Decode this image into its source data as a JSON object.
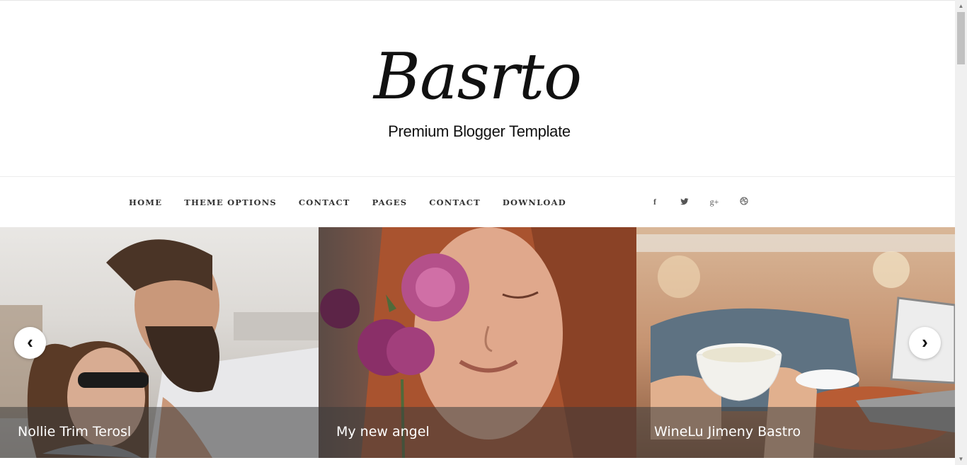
{
  "header": {
    "logo": "Basrto",
    "tagline": "Premium Blogger Template"
  },
  "nav": {
    "items": [
      "HOME",
      "THEME OPTIONS",
      "CONTACT",
      "PAGES",
      "CONTACT",
      "DOWNLOAD"
    ]
  },
  "social": {
    "icons": [
      "facebook-icon",
      "twitter-icon",
      "google-plus-icon",
      "dribbble-icon"
    ],
    "glyphs": [
      "f",
      "🐦",
      "g+",
      "⊛"
    ]
  },
  "slider": {
    "slides": [
      {
        "caption": "Nollie Trim Terosl"
      },
      {
        "caption": "My new angel"
      },
      {
        "caption": "WineLu Jimeny Bastro"
      }
    ],
    "prev_glyph": "‹",
    "next_glyph": "›"
  },
  "colors": {
    "text": "#111111",
    "nav_text": "#333333",
    "caption_overlay": "rgba(60,60,60,0.55)"
  }
}
